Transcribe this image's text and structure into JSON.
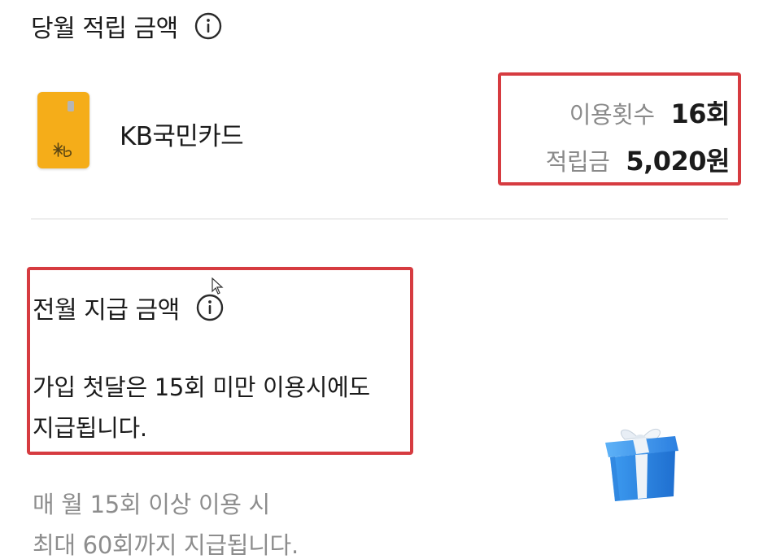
{
  "current_month": {
    "title": "당월 적립 금액",
    "info_icon": "info-circle-icon",
    "card": {
      "name": "KB국민카드",
      "icon": "kb-card-icon",
      "card_color": "#f5ad19"
    },
    "stats": {
      "usage_count_label": "이용횟수",
      "usage_count_value": "16회",
      "reward_label": "적립금",
      "reward_value": "5,020원"
    }
  },
  "previous_month": {
    "title": "전월 지급 금액",
    "info_icon": "info-circle-icon",
    "notice_lines": [
      "가입 첫달은 15회 미만 이용시에도",
      "지급됩니다."
    ]
  },
  "description_lines": [
    "매 월 15회 이상 이용 시",
    "최대 60회까지 지급됩니다."
  ],
  "illustration": "gift-box-icon",
  "colors": {
    "highlight_border": "#d63b40",
    "muted_text": "#8a8a8a",
    "gift_blue": "#2e86e6"
  }
}
